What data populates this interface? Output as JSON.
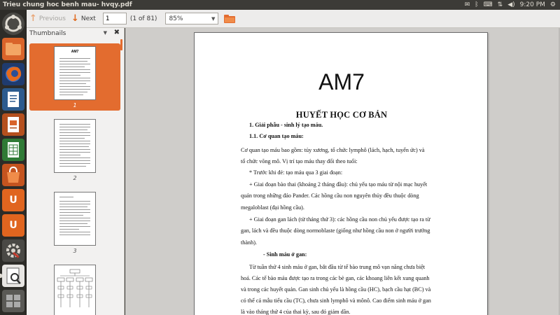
{
  "window": {
    "title": "Trieu chung hoc benh mau- hvqy.pdf",
    "clock": "9:20 PM"
  },
  "launcher": {
    "items": [
      {
        "name": "dash-icon"
      },
      {
        "name": "home-folder-icon"
      },
      {
        "name": "firefox-icon"
      },
      {
        "name": "writer-icon"
      },
      {
        "name": "impress-icon"
      },
      {
        "name": "calc-icon"
      },
      {
        "name": "software-center-icon"
      },
      {
        "name": "ubuntu-one-icon"
      },
      {
        "name": "ubuntu-one-music-icon"
      },
      {
        "name": "system-settings-icon"
      },
      {
        "name": "document-viewer-icon"
      },
      {
        "name": "workspace-switcher-icon"
      }
    ]
  },
  "toolbar": {
    "previous_label": "Previous",
    "next_label": "Next",
    "page_value": "1",
    "page_count": "(1 of 81)",
    "zoom_value": "85%"
  },
  "sidebar": {
    "title": "Thumbnails",
    "thumbnails": [
      {
        "num": "1",
        "title": "AM7"
      },
      {
        "num": "2"
      },
      {
        "num": "3"
      },
      {
        "num": ""
      }
    ]
  },
  "document": {
    "title": "AM7",
    "heading": "HUYẾT HỌC CƠ BẢN",
    "lines": [
      "1. Giải phẫu - sinh lý tạo máu.",
      "1.1. Cơ quan tạo máu:",
      "Cơ quan tạo máu bao gồm: tủy xương, tổ chức lymphô (lách, hạch, tuyến ức) và",
      "tổ chức võng mô. Vị trí tạo máu thay đổi theo tuổi:",
      "* Trước khi đẻ: tạo máu qua 3 giai đoạn:",
      "+ Giai đoạn bào thai (khoảng 2 tháng đầu): chủ yếu tạo máu từ nội mạc huyết",
      "quản trong những đảo Pander. Các hồng cầu non nguyên thủy đều thuộc dòng",
      "megaloblast (đại hồng cầu).",
      "+ Giai đoạn gan lách (từ tháng thứ 3): các hồng cầu non chủ yếu được tạo ra từ",
      "gan, lách và đều thuộc dòng normoblaste (giống như hồng cầu non ở người trưởng",
      "thành).",
      "- Sinh máu ở gan:",
      "Từ tuần thứ 4 sinh máu ở gan, bắt đầu từ tế bào trung mô vạn năng chưa biệt",
      "hoá. Các tế bào máu được tạo ra trong các bè gan, các khoang liên kết xung quanh",
      "và trong các huyết quản. Gan sinh chủ yếu là hồng cầu (HC), bạch cầu hạt (BC) và",
      "có thể cả mẫu tiểu cầu (TC), chưa sinh lymphô và mônô. Cao điểm sinh máu ở gan",
      "là vào tháng thứ 4 của thai kỳ, sau đó giảm dần."
    ]
  },
  "colors": {
    "accent": "#e36c2f",
    "panel": "#3c3b37",
    "toolbar": "#edeceb",
    "doc_bg": "#cfcdca"
  }
}
